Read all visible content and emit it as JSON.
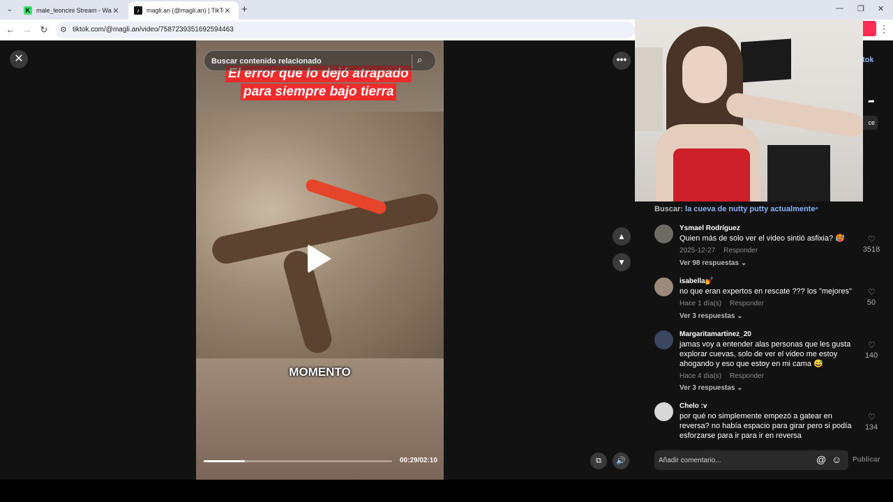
{
  "browser": {
    "tabs": [
      {
        "title": "male_leoncini Stream - Watch L",
        "icon": "kick-favicon",
        "active": false
      },
      {
        "title": "magli.an (@magli.an) | TikTok",
        "icon": "tiktok-favicon",
        "active": true
      }
    ],
    "new_tab_symbol": "+",
    "url": "tiktok.com/@magli.an/video/7587239351692594463"
  },
  "video": {
    "search_placeholder": "Buscar contenido relacionado",
    "title_line1": "El error que lo dejó atrapado",
    "title_line2": "para siempre bajo tierra",
    "caption": "MOMENTO",
    "time": "00:29/02:10",
    "progress_fraction": 0.22
  },
  "panel": {
    "search_label": "Buscar:",
    "search_query": "la cueva de nutty putty actualmente",
    "comments": [
      {
        "author": "Ysmael Rodríguez",
        "text": "Quien más de solo ver el video sintió asfixia? 🥵",
        "date": "2025-12-27",
        "reply": "Responder",
        "more": "Ver 98 respuestas",
        "likes": "3518"
      },
      {
        "author": "isabella💅",
        "text": "no que eran expertos en rescate ??? los \"mejores\"",
        "date": "Hace 1 día(s)",
        "reply": "Responder",
        "more": "Ver 3 respuestas",
        "likes": "50"
      },
      {
        "author": "Margaritamartinez_20",
        "text": "jamas voy a entender alas personas que les gusta explorar cuevas, solo de ver el video me estoy ahogando y eso que estoy en mi cama 😅",
        "date": "Hace 4 día(s)",
        "reply": "Responder",
        "more": "Ver 3 respuestas",
        "likes": "140"
      },
      {
        "author": "Chelo :v",
        "text": "por qué no simplemente empezó a gatear en reversa? no había espacio para girar pero si podía esforzarse para ir para ir en reversa",
        "likes": "134"
      }
    ],
    "composer_placeholder": "Añadir comentario...",
    "publish_label": "Publicar"
  },
  "colors": {
    "tiktok_red": "#fe2c55",
    "link_blue": "#8ab4f8",
    "page_bg": "#121212"
  }
}
